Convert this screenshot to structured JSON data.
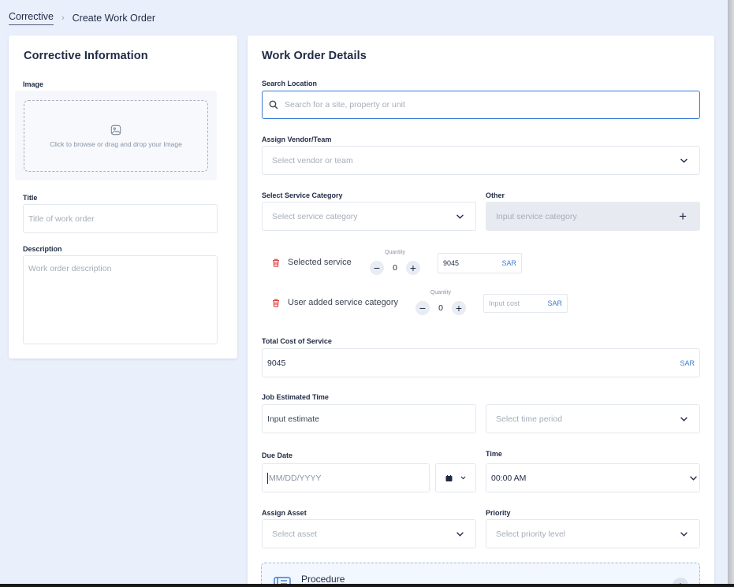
{
  "breadcrumb": {
    "parent": "Corrective",
    "separator": "›",
    "current": "Create Work Order"
  },
  "left": {
    "title": "Corrective Information",
    "image_label": "Image",
    "dropzone_text": "Click to browse or drag and drop your Image",
    "title_label": "Title",
    "title_placeholder": "Title of work order",
    "description_label": "Description",
    "description_placeholder": "Work order description"
  },
  "right": {
    "title": "Work Order Details",
    "search_label": "Search Location",
    "search_placeholder": "Search for a site, property or unit",
    "vendor_label": "Assign Vendor/Team",
    "vendor_placeholder": "Select vendor or team",
    "service_category_label": "Select Service Category",
    "service_category_placeholder": "Select service category",
    "other_label": "Other",
    "other_placeholder": "Input service category",
    "services": [
      {
        "name": "Selected service",
        "quantity_label": "Quantity",
        "quantity": "0",
        "cost": "9045",
        "currency": "SAR"
      },
      {
        "name": "User added service category",
        "quantity_label": "Quantity",
        "quantity": "0",
        "cost_placeholder": "Input cost",
        "currency": "SAR"
      }
    ],
    "total_label": "Total Cost of Service",
    "total_value": "9045",
    "total_currency": "SAR",
    "estimate_label": "Job Estimated Time",
    "estimate_placeholder": "Input estimate",
    "time_period_placeholder": "Select time period",
    "due_date_label": "Due Date",
    "due_date_placeholder": "MM/DD/YYYY",
    "time_label": "Time",
    "time_value": "00:00 AM",
    "asset_label": "Assign Asset",
    "asset_placeholder": "Select asset",
    "priority_label": "Priority",
    "priority_placeholder": "Select priority level",
    "procedure_title": "Procedure"
  },
  "colors": {
    "accent": "#3a7bd5",
    "danger": "#e04848",
    "background": "#eaf0fb"
  }
}
